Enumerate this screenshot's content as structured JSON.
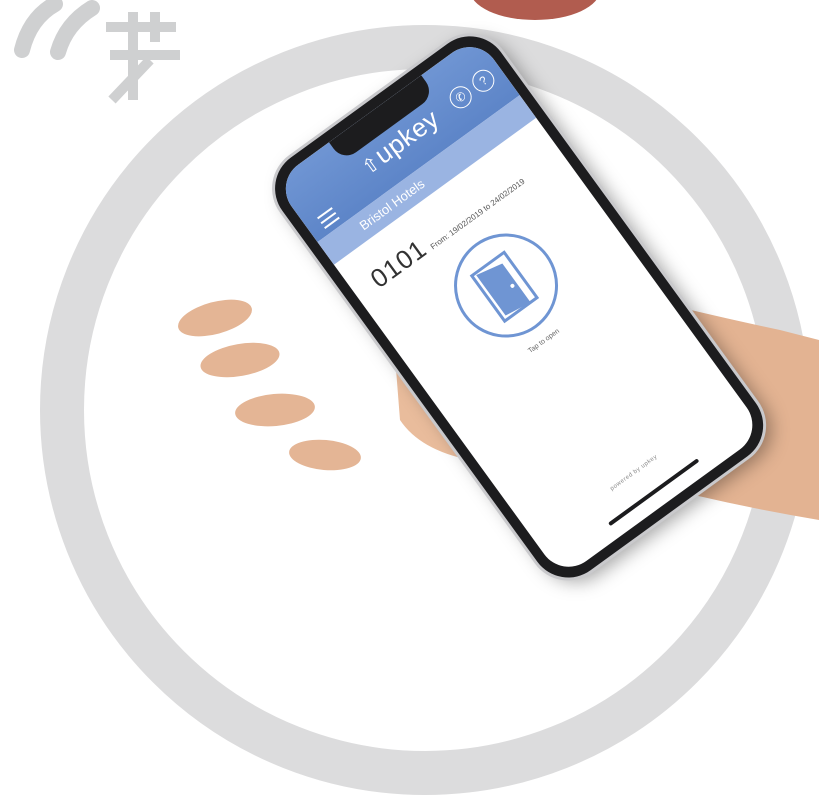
{
  "app": {
    "brand_name": "ûpkey",
    "brand_letters": "upkey",
    "hotel_name": "Bristol Hotels",
    "room_number": "0101",
    "dates_text": "From: 19/02/2019 to 24/02/2019",
    "tap_text": "Tap to open",
    "footer_text": "powered by upkey"
  },
  "icons": {
    "menu": "hamburger-menu-icon",
    "phone": "phone-icon",
    "info": "info-icon",
    "door": "open-door-icon",
    "logo": "wifi-key-logo"
  },
  "colors": {
    "accent": "#5d85c8",
    "accent_light": "#9ab4e2",
    "ring": "#dcdcdd",
    "logo_gray": "#cfd0d1"
  }
}
